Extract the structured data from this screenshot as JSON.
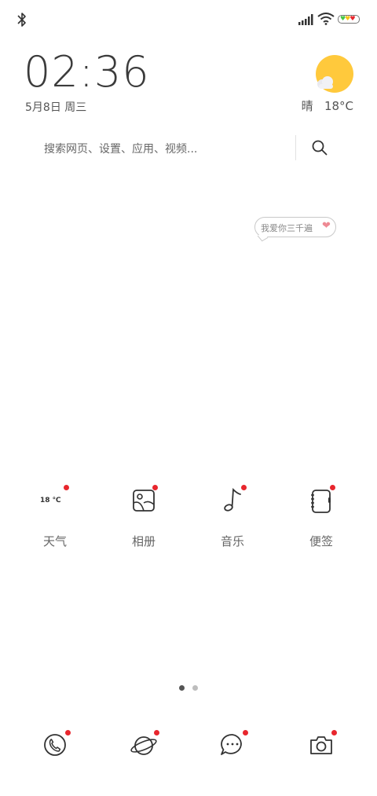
{
  "status_bar": {
    "bluetooth_icon": "bluetooth-icon",
    "signal_icon": "signal-bars-icon",
    "wifi_icon": "wifi-icon",
    "battery_icon": "battery-hearts-icon",
    "battery_hearts": "♥♥♥",
    "heart_colors": [
      "#47c748",
      "#f3c21a",
      "#e8262d"
    ]
  },
  "clock": {
    "time": "02:36",
    "date": "5月8日 周三"
  },
  "weather": {
    "condition": "晴",
    "temperature": "18°C",
    "sun_color": "#ffc93c"
  },
  "search": {
    "placeholder": "搜索网页、设置、应用、视频..."
  },
  "bubble": {
    "text": "我爱你三千遍",
    "heart": "❤"
  },
  "apps": [
    {
      "label": "天气",
      "icon": "weather-icon",
      "widget_text": "18 ℃"
    },
    {
      "label": "相册",
      "icon": "gallery-icon"
    },
    {
      "label": "音乐",
      "icon": "music-note-icon"
    },
    {
      "label": "便签",
      "icon": "notebook-icon"
    }
  ],
  "pager": {
    "pages": 2,
    "current": 1
  },
  "dock": [
    {
      "icon": "phone-icon"
    },
    {
      "icon": "browser-planet-icon"
    },
    {
      "icon": "message-icon"
    },
    {
      "icon": "camera-icon"
    }
  ],
  "colors": {
    "badge": "#e8262d",
    "text": "#444444",
    "accent_heart": "#ee8a94"
  }
}
